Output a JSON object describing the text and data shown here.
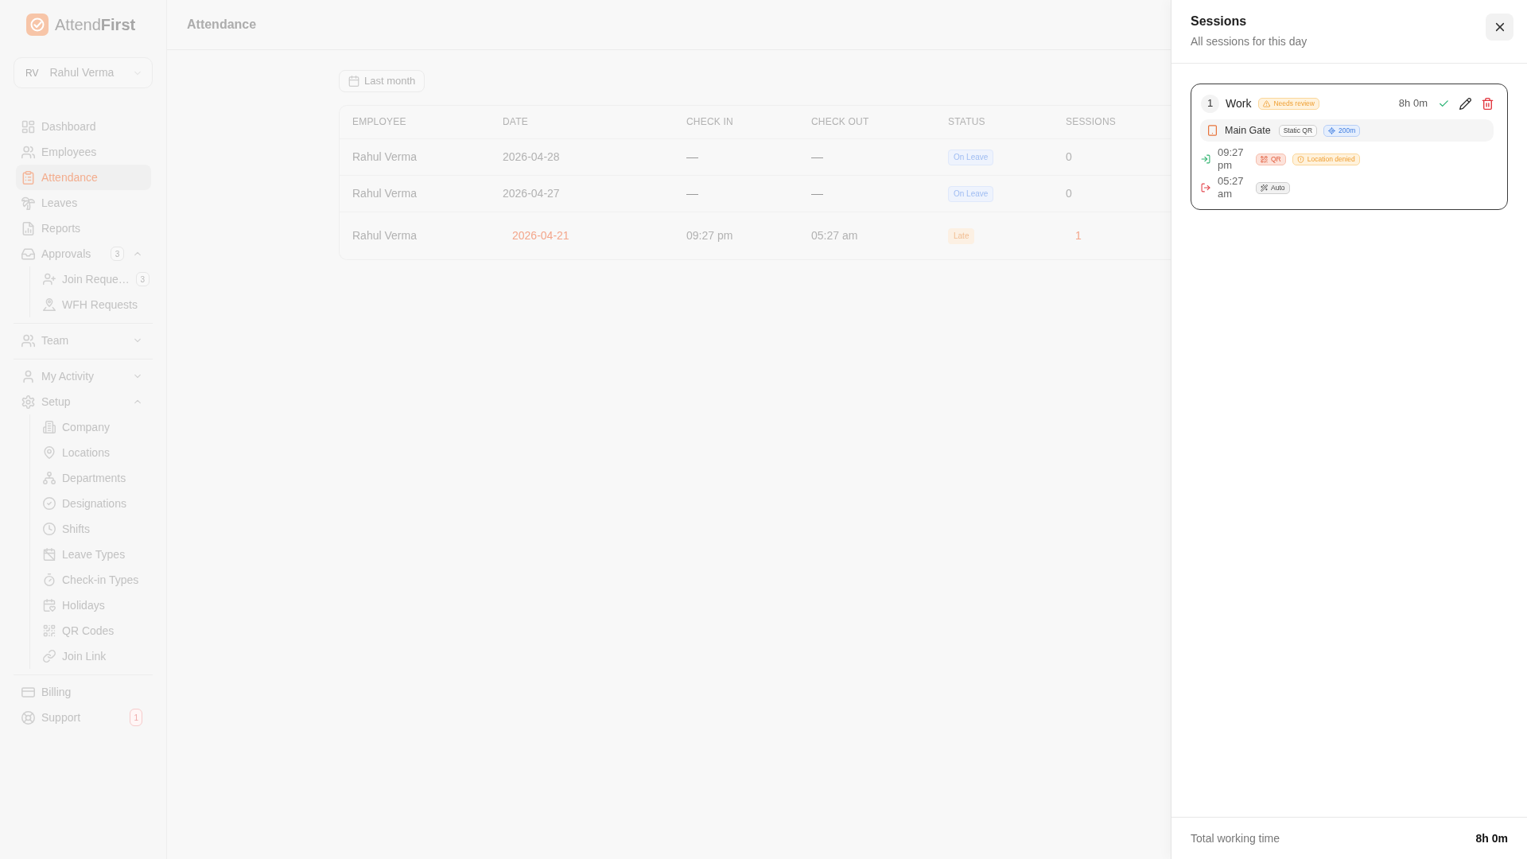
{
  "sidebar": {
    "brand": "Attend**First**",
    "user": {
      "initials": "RV",
      "name": "Rahul Verma"
    },
    "sections": [
      {
        "items": [
          {
            "label": "Dashboard",
            "selected": false
          },
          {
            "label": "Employees",
            "selected": false
          },
          {
            "label": "Attendance",
            "selected": true
          },
          {
            "label": "Leaves",
            "selected": false
          },
          {
            "label": "Reports",
            "selected": false
          },
          {
            "label": "Approvals",
            "selected": false,
            "badge": {
              "text": "3",
              "kind": "count"
            },
            "expanded": true,
            "children": [
              {
                "label": "Join Reque…",
                "selected": false,
                "badge": {
                  "text": "3",
                  "kind": "count"
                }
              },
              {
                "label": "WFH Requests",
                "selected": false
              }
            ]
          }
        ]
      },
      {
        "items": [
          {
            "label": "Team",
            "selected": false,
            "expanded": false
          }
        ]
      },
      {
        "items": [
          {
            "label": "My Activity",
            "selected": false,
            "expanded": false
          },
          {
            "label": "Setup",
            "selected": false,
            "expanded": true,
            "children": [
              {
                "label": "Company",
                "selected": false
              },
              {
                "label": "Locations",
                "selected": false
              },
              {
                "label": "Departments",
                "selected": false
              },
              {
                "label": "Designations",
                "selected": false
              },
              {
                "label": "Shifts",
                "selected": false
              },
              {
                "label": "Leave Types",
                "selected": false
              },
              {
                "label": "Check-in Types",
                "selected": false
              },
              {
                "label": "Holidays",
                "selected": false
              },
              {
                "label": "QR Codes",
                "selected": false
              },
              {
                "label": "Join Link",
                "selected": false
              }
            ]
          }
        ]
      },
      {
        "items": [
          {
            "label": "Billing",
            "selected": false
          },
          {
            "label": "Support",
            "selected": false,
            "badge": {
              "text": "1",
              "kind": "alert"
            }
          }
        ]
      }
    ]
  },
  "header": {
    "title": "Attendance"
  },
  "filter": {
    "label": "Last month"
  },
  "table": {
    "columns": [
      "EMPLOYEE",
      "DATE",
      "CHECK IN",
      "CHECK OUT",
      "STATUS",
      "SESSIONS"
    ],
    "rows": [
      {
        "employee": "Rahul Verma",
        "date": "2026-04-28",
        "check_in": "—",
        "check_out": "—",
        "status": {
          "text": "On Leave",
          "kind": "leave"
        },
        "sessions": "0",
        "selected": false
      },
      {
        "employee": "Rahul Verma",
        "date": "2026-04-27",
        "check_in": "—",
        "check_out": "—",
        "status": {
          "text": "On Leave",
          "kind": "leave"
        },
        "sessions": "0",
        "selected": false
      },
      {
        "employee": "Rahul Verma",
        "date": "2026-04-21",
        "check_in": "09:27 pm",
        "check_out": "05:27 am",
        "status": {
          "text": "Late",
          "kind": "late"
        },
        "sessions": "1",
        "selected": true
      }
    ]
  },
  "sessions_panel": {
    "title": "Sessions",
    "subtitle": "All sessions for this day",
    "sessions": [
      {
        "number": "1",
        "type": "Work",
        "flag": "Needs review",
        "duration": "8h 0m",
        "location": {
          "name": "Main Gate",
          "method": "Static QR",
          "radius": "200m"
        },
        "events": [
          {
            "kind": "in",
            "time": "09:27 pm",
            "tags": [
              {
                "kind": "qr",
                "label": "QR"
              },
              {
                "kind": "warning",
                "label": "Location denied"
              }
            ]
          },
          {
            "kind": "out",
            "time": "05:27 am",
            "tags": [
              {
                "kind": "auto",
                "label": "Auto"
              }
            ]
          }
        ]
      }
    ],
    "footer": {
      "label": "Total working time",
      "value": "8h 0m"
    }
  }
}
